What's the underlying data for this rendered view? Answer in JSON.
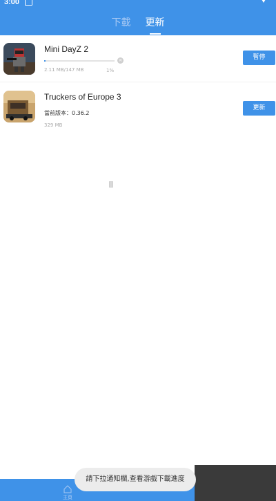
{
  "status": {
    "time": "3:00"
  },
  "tabs": [
    {
      "label": "下載",
      "active": false
    },
    {
      "label": "更新",
      "active": true
    }
  ],
  "items": [
    {
      "name": "Mini DayZ 2",
      "size": "2.11 MB/147 MB",
      "progress_percent": "1%",
      "progress_value": 0.01,
      "button": "暫停",
      "icon": "mini-dayz-2-icon"
    },
    {
      "name": "Truckers of Europe 3",
      "version": "當前版本：0.36.2",
      "size": "329 MB",
      "button": "更新",
      "icon": "truckers-of-europe-3-icon"
    }
  ],
  "toast": "請下拉通知欄,查看游戲下載進度",
  "bottom_nav": {
    "home_label": "主頁"
  },
  "colors": {
    "accent": "#3f92e8",
    "tab_inactive": "#a8c9f4",
    "toast_bg": "#ececec"
  }
}
